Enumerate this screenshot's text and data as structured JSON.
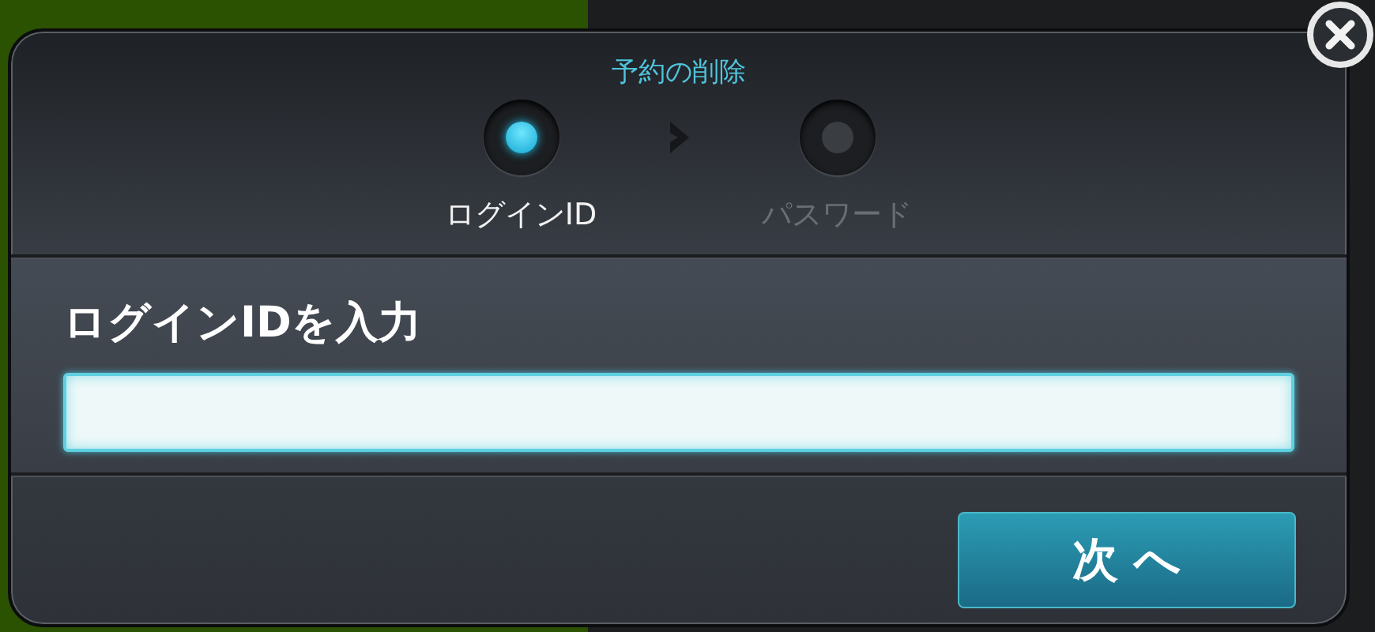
{
  "dialog": {
    "title": "予約の削除",
    "steps": [
      {
        "label": "ログインID",
        "selected": true
      },
      {
        "label": "パスワード",
        "selected": false
      }
    ],
    "heading": "ログインIDを入力",
    "next_button": "次 へ"
  }
}
